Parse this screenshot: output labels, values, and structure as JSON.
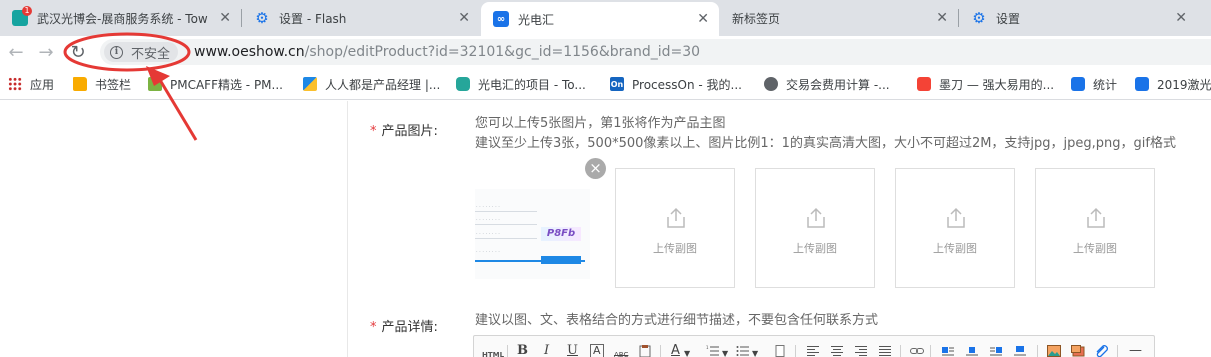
{
  "tabs": [
    {
      "title": "武汉光博会-展商服务系统 - Tow",
      "badge": "1",
      "icon": "oeshow-badge-icon"
    },
    {
      "title": "设置 - Flash",
      "icon": "gear-icon"
    },
    {
      "title": "光电汇",
      "icon": "guangdianhui-icon",
      "active": true
    },
    {
      "title": "新标签页"
    },
    {
      "title": "设置",
      "icon": "gear-icon"
    }
  ],
  "toolbar": {
    "security_text": "不安全",
    "url_host": "www.oeshow.cn",
    "url_path": "/shop/editProduct?id=32101&gc_id=1156&brand_id=30"
  },
  "bookmarks": [
    {
      "label": "应用",
      "icon": "apps-grid-icon"
    },
    {
      "label": "书签栏",
      "icon": "folder-icon"
    },
    {
      "label": "PMCAFF精选 - PM...",
      "icon": "pmcaff-icon"
    },
    {
      "label": "人人都是产品经理 |...",
      "icon": "woshipm-icon"
    },
    {
      "label": "光电汇的项目 - To...",
      "icon": "tower-icon"
    },
    {
      "label": "ProcessOn - 我的...",
      "icon": "processon-icon",
      "icon_text": "On"
    },
    {
      "label": "交易会费用计算 -...",
      "icon": "globe-icon"
    },
    {
      "label": "墨刀 — 强大易用的...",
      "icon": "modao-icon"
    },
    {
      "label": "统计",
      "icon": "guangdianhui-icon"
    },
    {
      "label": "2019激光",
      "icon": "guangdianhui-icon"
    }
  ],
  "form": {
    "required_mark": "*",
    "product_image": {
      "label": "产品图片:",
      "hint1": "您可以上传5张图片，第1张将作为产品主图",
      "hint2": "建议至少上传3张，500*500像素以上、图片比例1：1的真实高清大图，大小不可超过2M，支持jpg，jpeg,png，gif格式",
      "remove_icon": "close-circle-icon",
      "captcha_text": "P8Fb",
      "upload_slots": [
        "上传副图",
        "上传副图",
        "上传副图",
        "上传副图"
      ]
    },
    "product_detail": {
      "label": "产品详情:",
      "hint": "建议以图、文、表格结合的方式进行细节描述，不要包含任何联系方式"
    }
  },
  "editor_toolbar": {
    "html": "HTML",
    "bold": "B",
    "italic": "I",
    "underline": "U",
    "font_box": "A",
    "strike": "ABC",
    "font_color": "A",
    "hr": "—"
  },
  "colors": {
    "required": "#e4393c",
    "annotation": "#e53935",
    "link_blue": "#1a73e8"
  }
}
